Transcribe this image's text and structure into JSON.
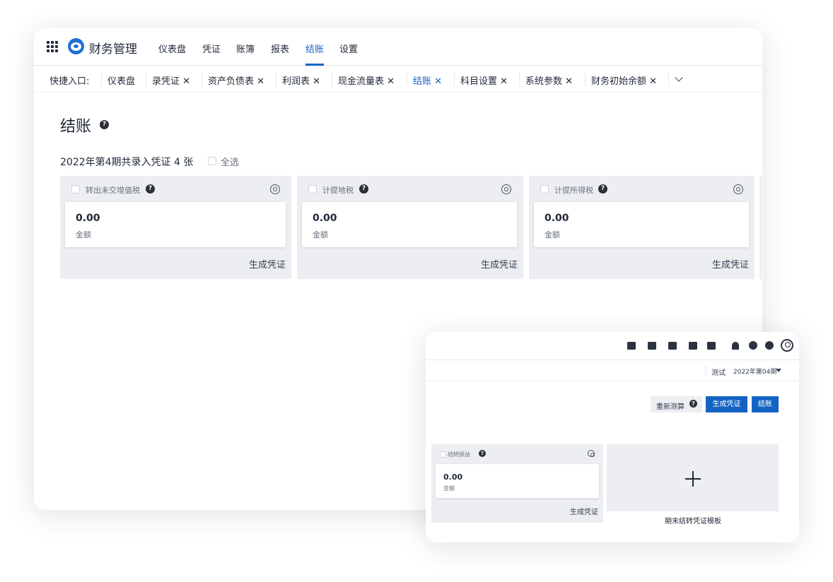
{
  "app": {
    "name": "财务管理"
  },
  "nav": {
    "items": [
      "仪表盘",
      "凭证",
      "账簿",
      "报表",
      "结账",
      "设置"
    ],
    "active": "结账"
  },
  "quickbar": {
    "label": "快捷入口:",
    "tabs": [
      "仪表盘",
      "录凭证 ✕",
      "资产负债表 ✕",
      "利润表 ✕",
      "现金流量表 ✕",
      "结账 ✕",
      "科目设置 ✕",
      "系统参数 ✕",
      "财务初始余额 ✕"
    ],
    "active_index": 5
  },
  "page": {
    "title": "结账",
    "summary": "2022年第4期共录入凭证 4 张",
    "select_all": "全选"
  },
  "cards": [
    {
      "title": "转出未交增值税",
      "amount": "0.00",
      "amount_label": "金额",
      "action": "生成凭证"
    },
    {
      "title": "计提地税",
      "amount": "0.00",
      "amount_label": "金额",
      "action": "生成凭证"
    },
    {
      "title": "计提所得税",
      "amount": "0.00",
      "amount_label": "金额",
      "action": "生成凭证"
    }
  ],
  "secondary": {
    "toolbar_icons": [
      "calendar-check-icon",
      "user-icon",
      "document-icon",
      "phone-book-icon",
      "calendar-icon",
      "bell-icon",
      "help-icon",
      "gear-icon",
      "account-icon"
    ],
    "account": "测试",
    "period": "2022年第04期",
    "buttons": {
      "recalc": "重新测算",
      "generate": "生成凭证",
      "close": "结账"
    },
    "card": {
      "title": "结转损益",
      "amount": "0.00",
      "amount_label": "金额",
      "action": "生成凭证"
    },
    "template_label": "期末结转凭证模板"
  },
  "colors": {
    "accent": "#1463c4",
    "card_bg": "#eceef2"
  }
}
